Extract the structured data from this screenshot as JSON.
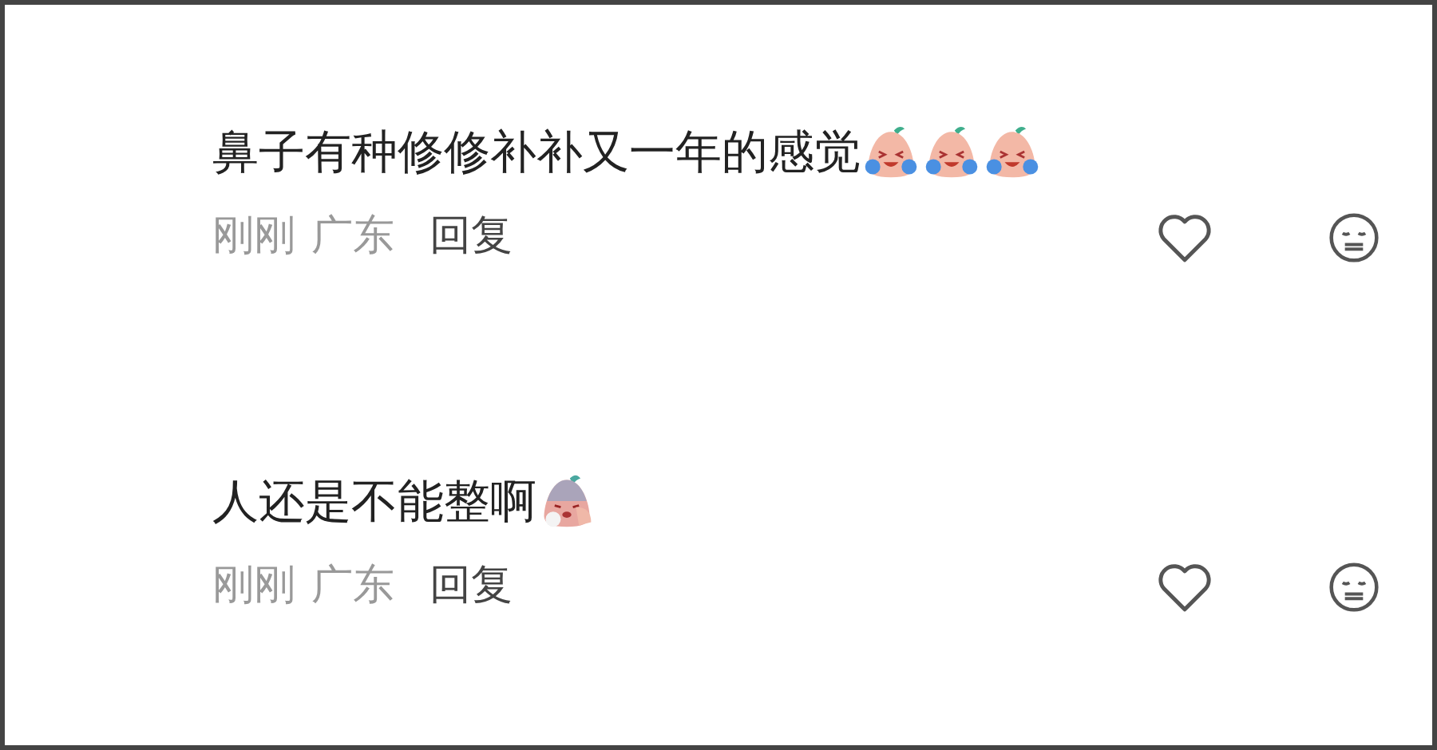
{
  "comments": [
    {
      "text": "鼻子有种修修补补又一年的感觉",
      "stickers": [
        {
          "kind": "tears"
        },
        {
          "kind": "tears"
        },
        {
          "kind": "tears"
        }
      ],
      "time": "刚刚",
      "location": "广东",
      "reply": "回复"
    },
    {
      "text": "人还是不能整啊",
      "stickers": [
        {
          "kind": "sick"
        }
      ],
      "time": "刚刚",
      "location": "广东",
      "reply": "回复"
    }
  ]
}
